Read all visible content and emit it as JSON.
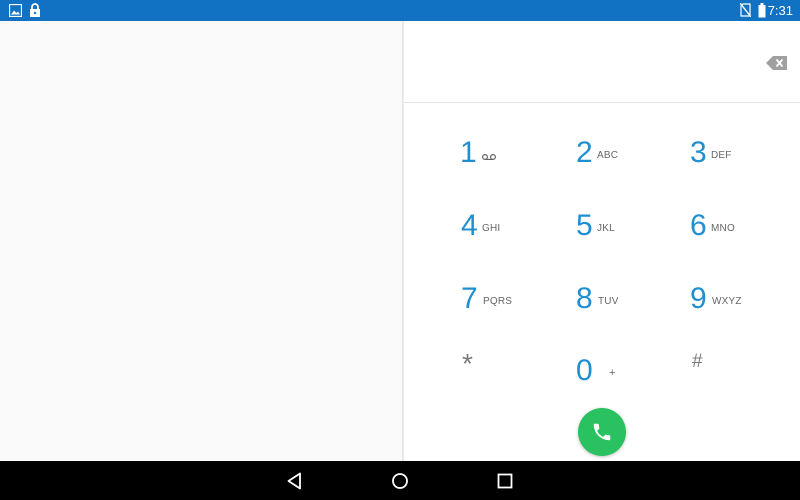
{
  "status_bar": {
    "time": "7:31",
    "icons_left": [
      "image-icon",
      "lock-icon"
    ],
    "icons_right": [
      "no-sim-icon",
      "battery-icon"
    ],
    "color": "#1172c3"
  },
  "dialer": {
    "number": "",
    "accent_color": "#1f8fd0",
    "call_color": "#2ac160",
    "keys": [
      {
        "digit": "1",
        "letters": ""
      },
      {
        "digit": "2",
        "letters": "ABC"
      },
      {
        "digit": "3",
        "letters": "DEF"
      },
      {
        "digit": "4",
        "letters": "GHI"
      },
      {
        "digit": "5",
        "letters": "JKL"
      },
      {
        "digit": "6",
        "letters": "MNO"
      },
      {
        "digit": "7",
        "letters": "PQRS"
      },
      {
        "digit": "8",
        "letters": "TUV"
      },
      {
        "digit": "9",
        "letters": "WXYZ"
      },
      {
        "digit": "*",
        "letters": ""
      },
      {
        "digit": "0",
        "letters": "+"
      },
      {
        "digit": "#",
        "letters": ""
      }
    ]
  },
  "nav_bar": {
    "buttons": [
      "back-icon",
      "home-icon",
      "recents-icon"
    ]
  }
}
